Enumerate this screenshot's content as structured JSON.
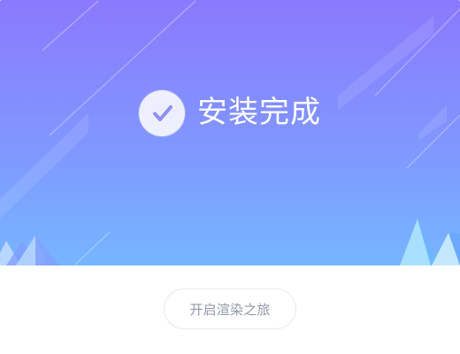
{
  "title": "安装完成",
  "button_label": "开启渲染之旅",
  "icons": {
    "success": "check-circle-icon"
  },
  "colors": {
    "banner_top": "#8b79fd",
    "banner_bottom": "#76b6ff",
    "button_text": "#8f98a8",
    "button_border": "#e7e9ef"
  }
}
